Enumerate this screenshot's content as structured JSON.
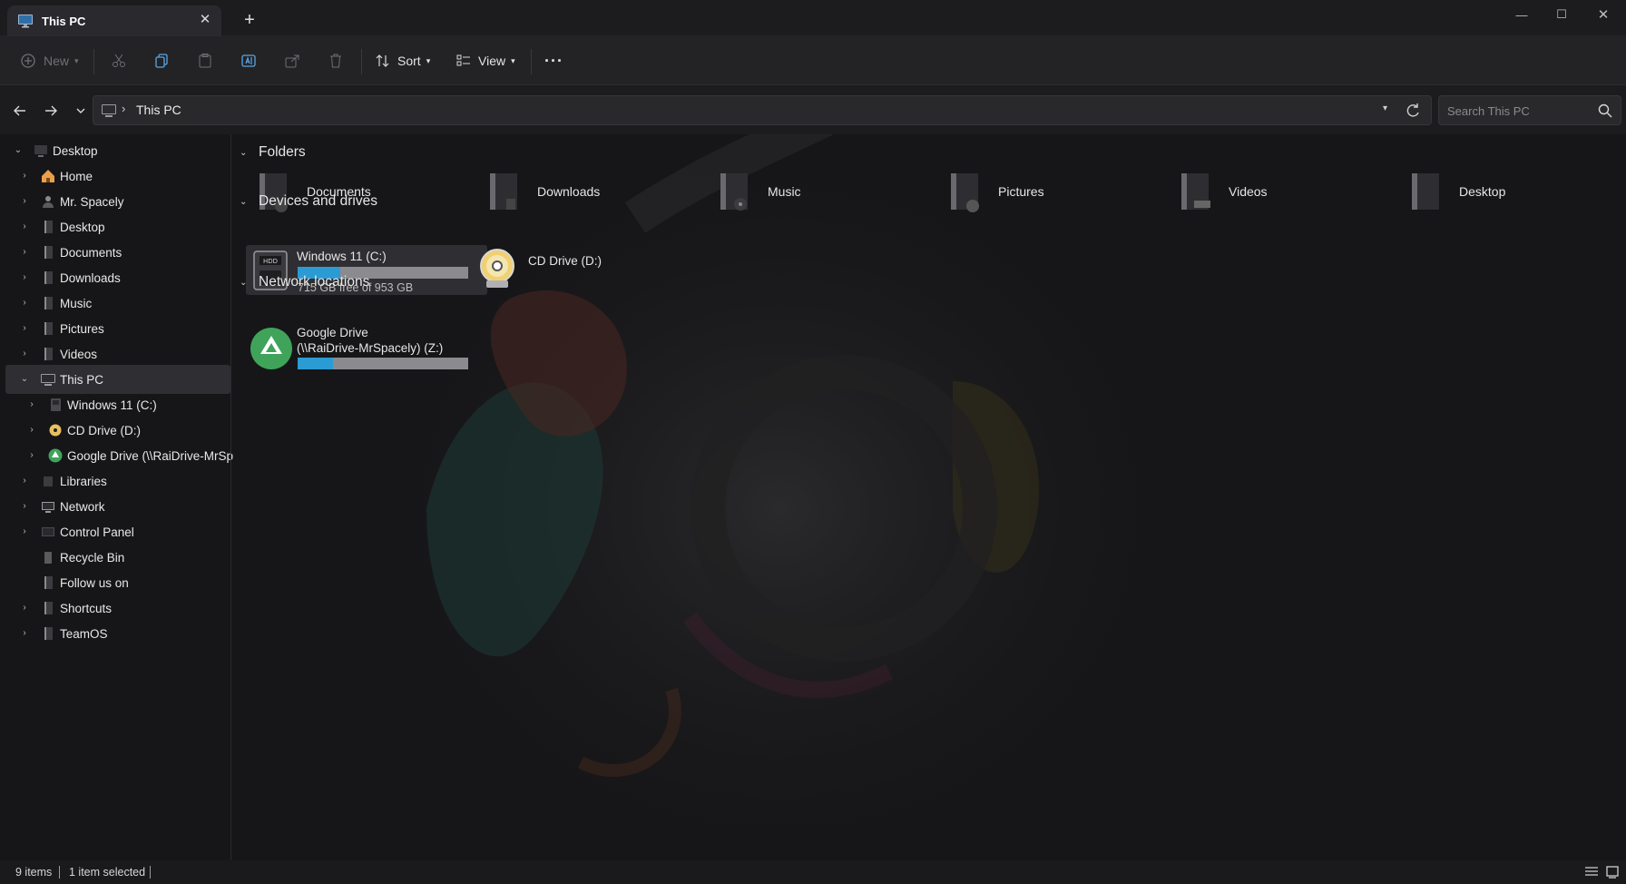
{
  "window": {
    "tab_title": "This PC",
    "new_tab_label": "+"
  },
  "command_bar": {
    "new_label": "New",
    "sort_label": "Sort",
    "view_label": "View",
    "more_label": "···"
  },
  "address": {
    "path": "This PC",
    "search_placeholder": "Search This PC"
  },
  "nav_pane": {
    "desktop_root": "Desktop",
    "items": [
      {
        "label": "Home",
        "icon": "home-icon"
      },
      {
        "label": "Mr. Spacely",
        "icon": "user-folder-icon"
      },
      {
        "label": "Desktop",
        "icon": "desktop-folder-icon"
      },
      {
        "label": "Documents",
        "icon": "documents-folder-icon"
      },
      {
        "label": "Downloads",
        "icon": "downloads-folder-icon"
      },
      {
        "label": "Music",
        "icon": "music-folder-icon"
      },
      {
        "label": "Pictures",
        "icon": "pictures-folder-icon"
      },
      {
        "label": "Videos",
        "icon": "videos-folder-icon"
      }
    ],
    "this_pc": "This PC",
    "this_pc_children": [
      {
        "label": "Windows 11 (C:)",
        "icon": "hdd-icon"
      },
      {
        "label": "CD Drive (D:)",
        "icon": "cd-icon"
      },
      {
        "label": "Google Drive (\\\\RaiDrive-MrSp",
        "icon": "google-drive-icon"
      }
    ],
    "bottom_items": [
      {
        "label": "Libraries",
        "icon": "libraries-icon",
        "expandable": true
      },
      {
        "label": "Network",
        "icon": "network-icon",
        "expandable": true
      },
      {
        "label": "Control Panel",
        "icon": "control-panel-icon",
        "expandable": true
      },
      {
        "label": "Recycle Bin",
        "icon": "recycle-bin-icon",
        "expandable": false
      },
      {
        "label": "Follow us on",
        "icon": "folder-icon",
        "expandable": false
      },
      {
        "label": "Shortcuts",
        "icon": "folder-icon",
        "expandable": true
      },
      {
        "label": "TeamOS",
        "icon": "folder-icon",
        "expandable": true
      }
    ]
  },
  "content": {
    "folders_header": "Folders",
    "folders": [
      "Documents",
      "Downloads",
      "Music",
      "Pictures",
      "Videos",
      "Desktop"
    ],
    "devices_header": "Devices and drives",
    "drive_c": {
      "label": "Windows 11 (C:)",
      "free_text": "715 GB free of 953 GB",
      "used_fraction": 0.25
    },
    "drive_d": {
      "label": "CD Drive (D:)"
    },
    "network_header": "Network locations",
    "gdrive": {
      "label_line1": "Google Drive",
      "label_line2": "(\\\\RaiDrive-MrSpacely) (Z:)",
      "used_fraction": 0.21
    }
  },
  "status": {
    "items_count": "9 items",
    "selected": "1 item selected"
  },
  "colors": {
    "accent": "#2b9bd4",
    "background": "#161618",
    "selection": "#2e2e33"
  }
}
